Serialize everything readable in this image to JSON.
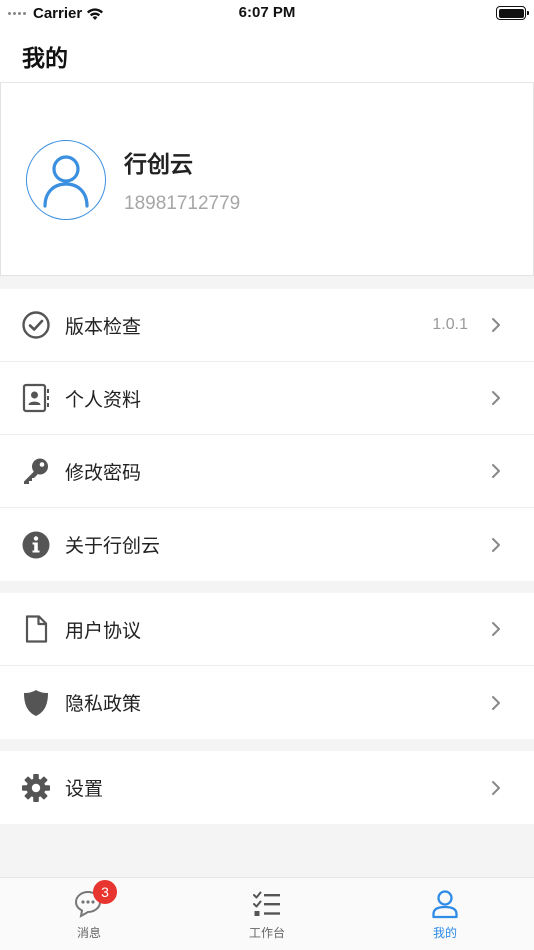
{
  "status_bar": {
    "carrier": "Carrier",
    "time": "6:07 PM"
  },
  "header": {
    "title": "我的"
  },
  "profile": {
    "name": "行创云",
    "phone": "18981712779"
  },
  "groups": [
    {
      "items": [
        {
          "label": "版本检查",
          "value": "1.0.1",
          "icon": "check-circle-icon"
        },
        {
          "label": "个人资料",
          "icon": "contact-card-icon"
        },
        {
          "label": "修改密码",
          "icon": "key-icon"
        },
        {
          "label": "关于行创云",
          "icon": "info-icon"
        }
      ]
    },
    {
      "items": [
        {
          "label": "用户协议",
          "icon": "document-icon"
        },
        {
          "label": "隐私政策",
          "icon": "shield-icon"
        }
      ]
    },
    {
      "items": [
        {
          "label": "设置",
          "icon": "gear-icon"
        }
      ]
    }
  ],
  "tabbar": {
    "tabs": [
      {
        "label": "消息",
        "badge": "3",
        "icon": "message-bubbles-icon"
      },
      {
        "label": "工作台",
        "icon": "checklist-icon"
      },
      {
        "label": "我的",
        "icon": "user-icon",
        "active": true
      }
    ]
  },
  "colors": {
    "accent": "#2e8be6",
    "badge": "#e8352f",
    "icon_gray": "#555555"
  }
}
